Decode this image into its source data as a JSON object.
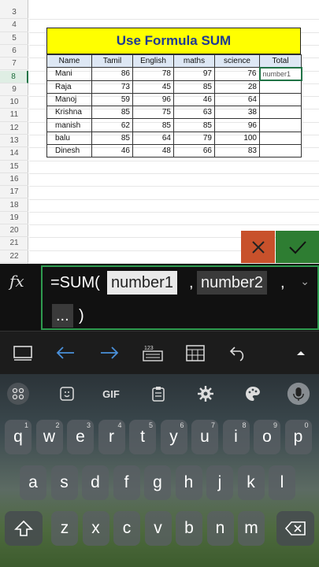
{
  "sheet": {
    "row_numbers": [
      "3",
      "4",
      "5",
      "6",
      "7",
      "8",
      "9",
      "10",
      "11",
      "12",
      "13",
      "14",
      "15",
      "16",
      "17",
      "18",
      "19",
      "20",
      "21",
      "22"
    ],
    "selected_row": "8",
    "title": "Use Formula  SUM",
    "headers": [
      "Name",
      "Tamil",
      "English",
      "maths",
      "science",
      "Total"
    ],
    "rows": [
      {
        "name": "Mani",
        "tamil": "86",
        "english": "78",
        "maths": "97",
        "science": "76",
        "total": "number1"
      },
      {
        "name": "Raja",
        "tamil": "73",
        "english": "45",
        "maths": "85",
        "science": "28",
        "total": ""
      },
      {
        "name": "Manoj",
        "tamil": "59",
        "english": "96",
        "maths": "46",
        "science": "64",
        "total": ""
      },
      {
        "name": "Krishna",
        "tamil": "85",
        "english": "75",
        "maths": "63",
        "science": "38",
        "total": ""
      },
      {
        "name": "manish",
        "tamil": "62",
        "english": "85",
        "maths": "85",
        "science": "96",
        "total": ""
      },
      {
        "name": "balu",
        "tamil": "85",
        "english": "64",
        "maths": "79",
        "science": "100",
        "total": ""
      },
      {
        "name": "Dinesh",
        "tamil": "46",
        "english": "48",
        "maths": "66",
        "science": "83",
        "total": ""
      }
    ]
  },
  "actions": {
    "cancel_icon": "close-icon",
    "accept_icon": "check-icon"
  },
  "formula_bar": {
    "fx": "fx",
    "prefix": "=SUM(",
    "arg1": "number1",
    "sep1": ",",
    "arg2": "number2",
    "sep2": ",",
    "arg3": "...",
    "suffix": ")"
  },
  "toolbar": {
    "icons": [
      "keyboard-hide-icon",
      "arrow-left-icon",
      "arrow-right-icon",
      "numeric-keyboard-icon",
      "calendar-icon",
      "undo-icon",
      "caret-up-icon"
    ]
  },
  "keyboard": {
    "top_row": [
      "apps-icon",
      "sticker-icon",
      "GIF",
      "clipboard-icon",
      "settings-icon",
      "palette-icon",
      "microphone-icon"
    ],
    "gif_label": "GIF",
    "row1": [
      {
        "k": "q",
        "h": "1"
      },
      {
        "k": "w",
        "h": "2"
      },
      {
        "k": "e",
        "h": "3"
      },
      {
        "k": "r",
        "h": "4"
      },
      {
        "k": "t",
        "h": "5"
      },
      {
        "k": "y",
        "h": "6"
      },
      {
        "k": "u",
        "h": "7"
      },
      {
        "k": "i",
        "h": "8"
      },
      {
        "k": "o",
        "h": "9"
      },
      {
        "k": "p",
        "h": "0"
      }
    ],
    "row2": [
      "a",
      "s",
      "d",
      "f",
      "g",
      "h",
      "j",
      "k",
      "l"
    ],
    "row3": [
      "z",
      "x",
      "c",
      "v",
      "b",
      "n",
      "m"
    ]
  },
  "colors": {
    "accent": "#217346",
    "cancel": "#c8512b",
    "accept": "#2e7d32",
    "banner": "#ffff00",
    "title_text": "#1f3a93"
  }
}
